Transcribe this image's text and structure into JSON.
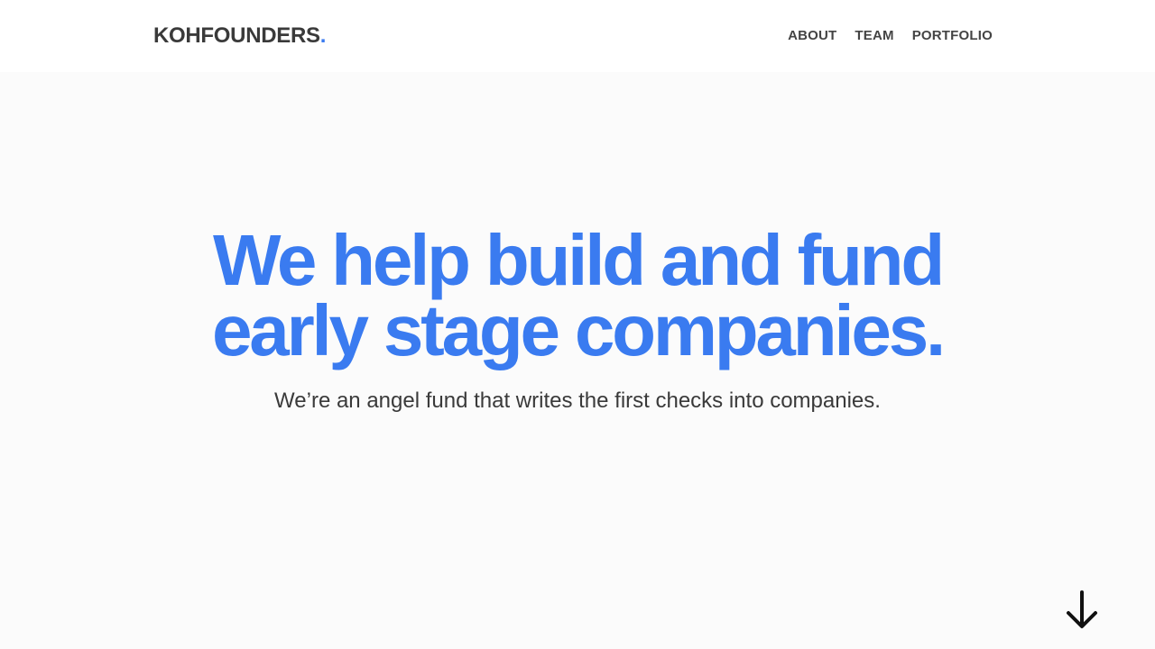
{
  "brand": {
    "name": "KOHFOUNDERS",
    "dot": ".",
    "accent_color": "#3a7bf0"
  },
  "nav": {
    "items": [
      {
        "label": "ABOUT"
      },
      {
        "label": "TEAM"
      },
      {
        "label": "PORTFOLIO"
      }
    ]
  },
  "hero": {
    "headline_line1": "We help build and fund",
    "headline_line2": "early stage companies.",
    "subtitle": "We’re an angel fund that writes the first checks into companies.",
    "scroll_icon": "arrow-down-icon"
  }
}
